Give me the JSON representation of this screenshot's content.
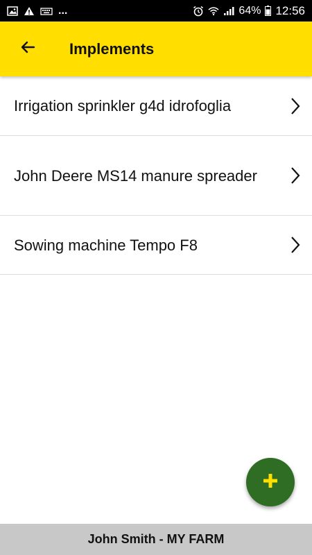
{
  "status_bar": {
    "left_icons": [
      "image-icon",
      "warning-icon",
      "keyboard-icon"
    ],
    "more": "...",
    "battery_pct": "64%",
    "time": "12:56"
  },
  "app_bar": {
    "title": "Implements",
    "background": "#ffde00"
  },
  "implements": [
    {
      "label": "Irrigation sprinkler g4d idrofoglia"
    },
    {
      "label": "John Deere MS14 manure spreader"
    },
    {
      "label": "Sowing machine Tempo F8"
    }
  ],
  "fab": {
    "icon": "plus-icon",
    "color": "#2e6d23",
    "icon_color": "#ffde00"
  },
  "footer": {
    "text": "John Smith - MY FARM"
  }
}
